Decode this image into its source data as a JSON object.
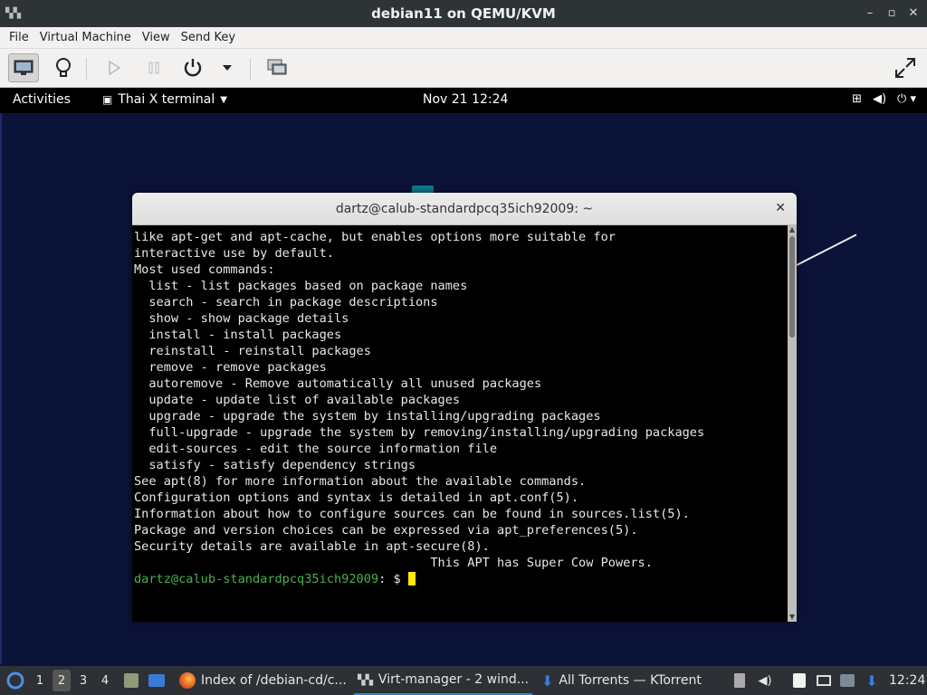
{
  "host_window": {
    "title": "debian11 on QEMU/KVM",
    "controls": [
      "–",
      "▫",
      "✕"
    ]
  },
  "menubar": {
    "items": [
      "File",
      "Virtual Machine",
      "View",
      "Send Key"
    ]
  },
  "toolbar": {
    "buttons": [
      {
        "name": "show-console",
        "icon": "monitor-icon",
        "active": true
      },
      {
        "name": "show-details",
        "icon": "lightbulb-icon"
      },
      {
        "name": "run",
        "icon": "play-icon",
        "disabled": true
      },
      {
        "name": "pause",
        "icon": "pause-icon",
        "disabled": true
      },
      {
        "name": "shutdown",
        "icon": "power-icon"
      },
      {
        "name": "shutdown-menu",
        "icon": "chevron-down-icon"
      },
      {
        "name": "snapshots",
        "icon": "snapshot-icon"
      },
      {
        "name": "fullscreen",
        "icon": "fullscreen-icon"
      }
    ]
  },
  "gnome_panel": {
    "activities": "Activities",
    "app_menu": "Thai X terminal",
    "clock": "Nov 21  12:24"
  },
  "terminal": {
    "title": "dartz@calub-standardpcq35ich92009: ~",
    "lines": [
      "like apt-get and apt-cache, but enables options more suitable for",
      "interactive use by default.",
      "",
      "Most used commands:",
      "  list - list packages based on package names",
      "  search - search in package descriptions",
      "  show - show package details",
      "  install - install packages",
      "  reinstall - reinstall packages",
      "  remove - remove packages",
      "  autoremove - Remove automatically all unused packages",
      "  update - update list of available packages",
      "  upgrade - upgrade the system by installing/upgrading packages",
      "  full-upgrade - upgrade the system by removing/installing/upgrading packages",
      "  edit-sources - edit the source information file",
      "  satisfy - satisfy dependency strings",
      "",
      "See apt(8) for more information about the available commands.",
      "Configuration options and syntax is detailed in apt.conf(5).",
      "Information about how to configure sources can be found in sources.list(5).",
      "Package and version choices can be expressed via apt_preferences(5).",
      "Security details are available in apt-secure(8).",
      "                                        This APT has Super Cow Powers."
    ],
    "prompt_user": "dartz@calub-standardpcq35ich92009",
    "prompt_suffix": ": $ "
  },
  "taskbar": {
    "workspaces": [
      "1",
      "2",
      "3",
      "4"
    ],
    "active_workspace": "2",
    "tasks": [
      {
        "label": "Index of /debian-cd/c...",
        "icon": "firefox-icon"
      },
      {
        "label": "Virt-manager - 2 wind...",
        "icon": "virt-manager-icon",
        "active": true
      },
      {
        "label": "All Torrents — KTorrent",
        "icon": "ktorrent-icon"
      }
    ],
    "clock": "12:24"
  }
}
